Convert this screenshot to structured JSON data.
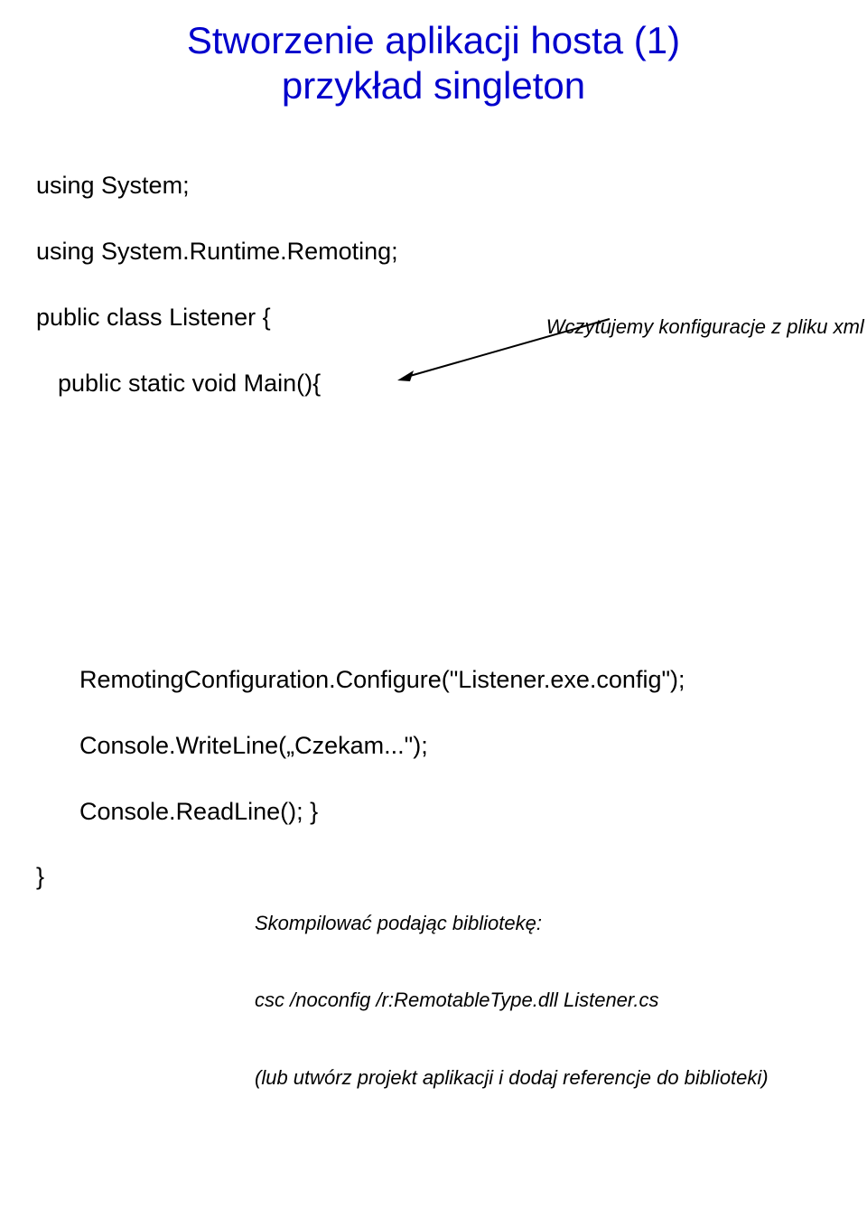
{
  "title_line1": "Stworzenie aplikacji hosta (1)",
  "title_line2": "przykład singleton",
  "code": {
    "l1": "using System;",
    "l2": "using System.Runtime.Remoting;",
    "l3": "public class Listener {",
    "l4": "public static void Main(){",
    "main_comment": "Wczytujemy konfiguracje z pliku xml",
    "l5": "RemotingConfiguration.Configure(\"Listener.exe.config\");",
    "l6": "Console.WriteLine(„Czekam...\");",
    "l7": "Console.ReadLine(); }",
    "rbrace": "}"
  },
  "comments": {
    "c1": "Skompilować podając bibliotekę:",
    "c2": "csc /noconfig /r:RemotableType.dll Listener.cs",
    "c3": "(lub utwórz projekt aplikacji i dodaj referencje do biblioteki)"
  }
}
